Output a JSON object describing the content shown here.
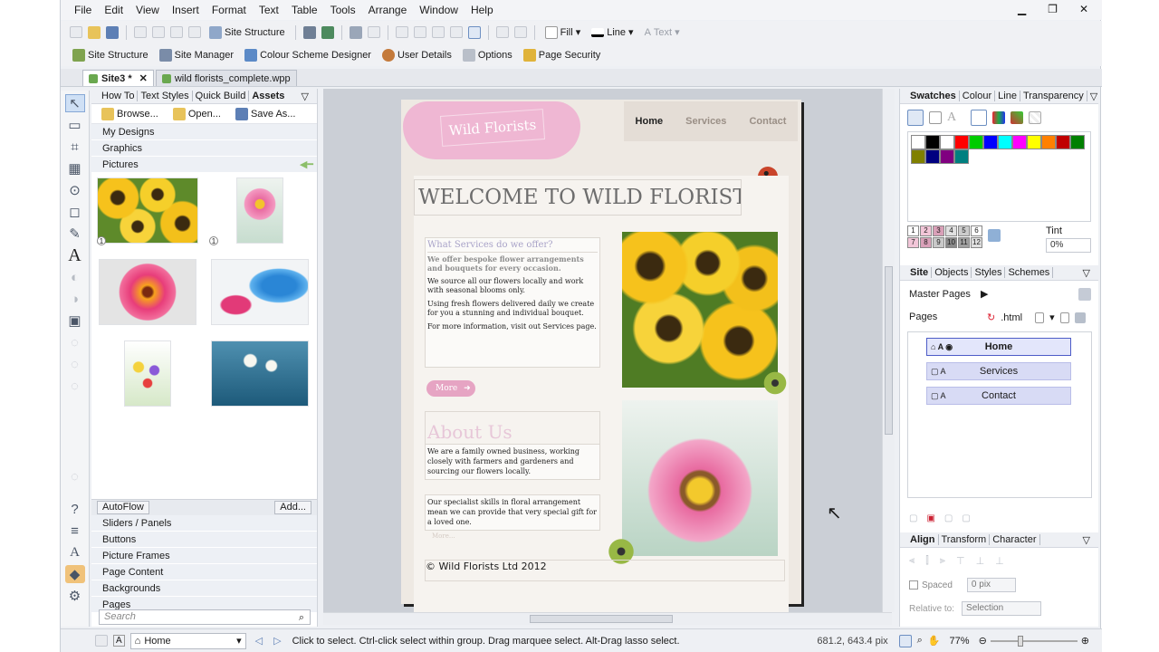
{
  "menu": [
    "File",
    "Edit",
    "View",
    "Insert",
    "Format",
    "Text",
    "Table",
    "Tools",
    "Arrange",
    "Window",
    "Help"
  ],
  "toolbar1": {
    "site_structure": "Site Structure",
    "fill": "Fill",
    "line": "Line",
    "text": "Text"
  },
  "toolbar2": {
    "site_structure": "Site Structure",
    "site_manager": "Site Manager",
    "colour_scheme": "Colour Scheme Designer",
    "user_details": "User Details",
    "options": "Options",
    "page_security": "Page Security"
  },
  "doc_tabs": [
    "Site3 *",
    "wild florists_complete.wpp"
  ],
  "left_panel": {
    "tabs": [
      "How To",
      "Text Styles",
      "Quick Build",
      "Assets"
    ],
    "actions": [
      "Browse...",
      "Open...",
      "Save As..."
    ],
    "categories_top": [
      "My Designs",
      "Graphics",
      "Pictures"
    ],
    "badge": "1",
    "autoflow": "AutoFlow",
    "add": "Add...",
    "categories_bottom": [
      "Sliders / Panels",
      "Buttons",
      "Picture Frames",
      "Page Content",
      "Backgrounds",
      "Pages"
    ],
    "search_placeholder": "Search"
  },
  "webpage": {
    "logo": "Wild Florists",
    "nav": [
      "Home",
      "Services",
      "Contact"
    ],
    "heading": "WELCOME TO WILD FLORISTS",
    "services_heading": "What Services do we offer?",
    "services_lead": "We offer bespoke flower arrangements and bouquets for every occasion.",
    "services_p1": "We source all our flowers locally and work with seasonal blooms only.",
    "services_p2": "Using fresh flowers delivered daily we create for you a stunning and individual bouquet.",
    "services_p3": "For more information, visit out Services page.",
    "more_button": "More",
    "about_heading": "About Us",
    "about_p1": "We are a family owned business, working closely with farmers and gardeners and sourcing our flowers locally.",
    "about_p2": "Our specialist skills in floral arrangement mean we can provide that very special gift for a loved one.",
    "more_link": "More...",
    "footer": "© Wild Florists Ltd 2012"
  },
  "right_panel": {
    "swatch_tabs": [
      "Swatches",
      "Colour",
      "Line",
      "Transparency"
    ],
    "tint_label": "Tint",
    "tint_value": "0%",
    "swatch_colors": [
      "#ffffff",
      "#000000",
      "#ffffff",
      "#ff0000",
      "#00cc00",
      "#0000ff",
      "#00ffff",
      "#ff00ff",
      "#ffff00",
      "#ff8000",
      "#c00000",
      "#008000",
      "#808000",
      "#000080",
      "#800080",
      "#008080"
    ],
    "scheme_numbers": [
      "1",
      "2",
      "3",
      "4",
      "5",
      "6",
      "7",
      "8",
      "9",
      "10",
      "11",
      "12"
    ],
    "site_tabs": [
      "Site",
      "Objects",
      "Styles",
      "Schemes"
    ],
    "master_pages": "Master Pages",
    "pages_label": "Pages",
    "html_label": ".html",
    "pages": [
      "Home",
      "Services",
      "Contact"
    ],
    "align_tabs": [
      "Align",
      "Transform",
      "Character"
    ],
    "spaced_label": "Spaced",
    "spacing_value": "0 pix",
    "relative_label": "Relative to:",
    "relative_value": "Selection"
  },
  "status": {
    "page_name": "Home",
    "hint": "Click to select. Ctrl-click select within group. Drag marquee select. Alt-Drag lasso select.",
    "coords": "681.2, 643.4 pix",
    "zoom": "77%"
  },
  "colors": {
    "accent_pink": "#e9a6c8",
    "logo_pink": "#efb7d3",
    "heading_gray": "#6d6d6d",
    "selection_blue": "#d8dbf5"
  }
}
